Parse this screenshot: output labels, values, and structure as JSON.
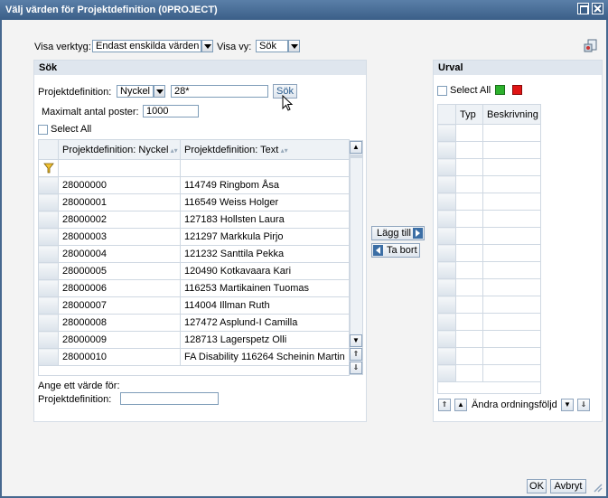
{
  "window": {
    "title": "Välj värden för Projektdefinition (0PROJECT)"
  },
  "toolbar": {
    "visa_verktyg_label": "Visa verktyg:",
    "visa_verktyg_value": "Endast enskilda värden",
    "visa_vy_label": "Visa vy:",
    "visa_vy_value": "Sök"
  },
  "search_panel": {
    "header": "Sök",
    "field_label": "Projektdefinition:",
    "key_select": "Nyckel",
    "search_value": "28*",
    "search_button": "Sök",
    "max_label": "Maximalt antal poster:",
    "max_value": "1000",
    "select_all": "Select All",
    "columns": [
      "Projektdefinition: Nyckel",
      "Projektdefinition: Text"
    ],
    "rows": [
      {
        "key": "28000000",
        "text": "114749 Ringbom Åsa"
      },
      {
        "key": "28000001",
        "text": "116549 Weiss Holger"
      },
      {
        "key": "28000002",
        "text": "127183 Hollsten Laura"
      },
      {
        "key": "28000003",
        "text": "121297 Markkula Pirjo"
      },
      {
        "key": "28000004",
        "text": "121232 Santtila Pekka"
      },
      {
        "key": "28000005",
        "text": "120490 Kotkavaara Kari"
      },
      {
        "key": "28000006",
        "text": "116253 Martikainen Tuomas"
      },
      {
        "key": "28000007",
        "text": "114004 Illman Ruth"
      },
      {
        "key": "28000008",
        "text": "127472 Asplund-I Camilla"
      },
      {
        "key": "28000009",
        "text": "128713 Lagerspetz Olli"
      },
      {
        "key": "28000010",
        "text": "FA Disability 116264 Scheinin Martin"
      }
    ],
    "enter_value_label": "Ange ett värde för:",
    "enter_field_label": "Projektdefinition:",
    "enter_field_value": ""
  },
  "middle": {
    "add_button": "Lägg till",
    "remove_button": "Ta bort"
  },
  "selection_panel": {
    "header": "Urval",
    "select_all": "Select All",
    "columns": [
      "Typ",
      "Beskrivning"
    ],
    "change_order_label": "Ändra ordningsföljd"
  },
  "footer": {
    "ok_button": "OK",
    "cancel_button": "Avbryt"
  },
  "colors": {
    "title_bar": "#3b5f88",
    "panel_header": "#dfe6ee",
    "green_status": "#2db12d",
    "red_status": "#e01414"
  }
}
